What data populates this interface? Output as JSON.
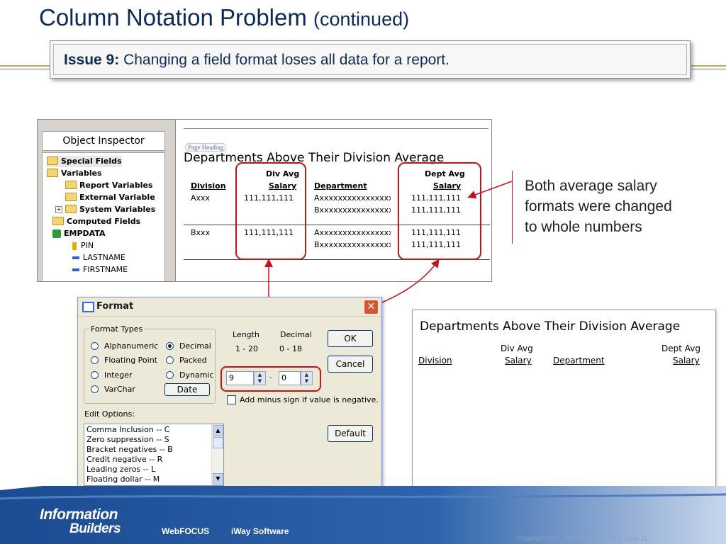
{
  "slide": {
    "title": "Column Notation Problem",
    "title_suffix": "(continued)",
    "issue_label": "Issue 9:",
    "issue_text": "Changing a field format loses all data for a report.",
    "note_lines": [
      "Both average salary",
      "formats were changed",
      "to whole numbers"
    ]
  },
  "object_inspector": {
    "title": "Object Inspector",
    "items": [
      {
        "label": "Special Fields",
        "type": "folder"
      },
      {
        "label": "Variables",
        "type": "folder"
      },
      {
        "label": "Report Variables",
        "type": "folder"
      },
      {
        "label": "External Variable",
        "type": "folder"
      },
      {
        "label": "System Variables",
        "type": "folder"
      },
      {
        "label": "Computed Fields",
        "type": "folder"
      },
      {
        "label": "EMPDATA",
        "type": "database"
      },
      {
        "label": "PIN",
        "type": "key"
      },
      {
        "label": "LASTNAME",
        "type": "field"
      },
      {
        "label": "FIRSTNAME",
        "type": "field"
      }
    ]
  },
  "report_design": {
    "page_heading_tag": "Page Heading",
    "title": "Departments Above Their Division Average",
    "col_division": "Division",
    "col_divavg_1": "Div Avg",
    "col_divavg_2": "Salary",
    "col_department": "Department",
    "col_deptavg_1": "Dept Avg",
    "col_deptavg_2": "Salary",
    "rows": [
      {
        "division": "Axxx",
        "div_avg": "111,111,111",
        "department": "Axxxxxxxxxxxxxxxxxxxx",
        "dept_avg": "111,111,111"
      },
      {
        "division": "",
        "div_avg": "",
        "department": "Bxxxxxxxxxxxxxxxxxxxx",
        "dept_avg": "111,111,111"
      },
      {
        "division": "Bxxx",
        "div_avg": "111,111,111",
        "department": "Axxxxxxxxxxxxxxxxxxxx",
        "dept_avg": "111,111,111"
      },
      {
        "division": "",
        "div_avg": "",
        "department": "Bxxxxxxxxxxxxxxxxxxxx",
        "dept_avg": "111,111,111"
      }
    ]
  },
  "format_dialog": {
    "title": "Format",
    "group_label": "Format Types",
    "types": [
      {
        "label": "Alphanumeric",
        "checked": false
      },
      {
        "label": "Floating Point",
        "checked": false
      },
      {
        "label": "Integer",
        "checked": false
      },
      {
        "label": "VarChar",
        "checked": false
      },
      {
        "label": "Decimal",
        "checked": true
      },
      {
        "label": "Packed",
        "checked": false
      },
      {
        "label": "Dynamic",
        "checked": false
      }
    ],
    "date_button": "Date",
    "length_label": "Length",
    "length_range": "1 - 20",
    "decimal_label": "Decimal",
    "decimal_range": "0 - 18",
    "length_value": "9",
    "decimal_value": "0",
    "separator": "·",
    "ok": "OK",
    "cancel": "Cancel",
    "default": "Default",
    "minus_sign_label": "Add minus sign if value is negative.",
    "edit_options_label": "Edit Options:",
    "edit_options": [
      "Comma Inclusion -- C",
      "Zero suppression -- S",
      "Bracket negatives -- B",
      "Credit negative  -- R",
      "Leading zeros -- L",
      "Floating dollar -- M"
    ]
  },
  "report_output": {
    "title": "Departments Above Their Division Average",
    "col_division": "Division",
    "col_divavg_1": "Div Avg",
    "col_divavg_2": "Salary",
    "col_department": "Department",
    "col_deptavg_1": "Dept Avg",
    "col_deptavg_2": "Salary"
  },
  "footer": {
    "logo_line1": "Information",
    "logo_line2": "Builders",
    "product1": "WebFOCUS",
    "product2": "iWay Software",
    "copyright": "Copyright 2007, Information Builders. Slide 31"
  },
  "colors": {
    "title": "#0b2a5a",
    "highlight": "#c0151b",
    "footer": "#1f4f95"
  }
}
